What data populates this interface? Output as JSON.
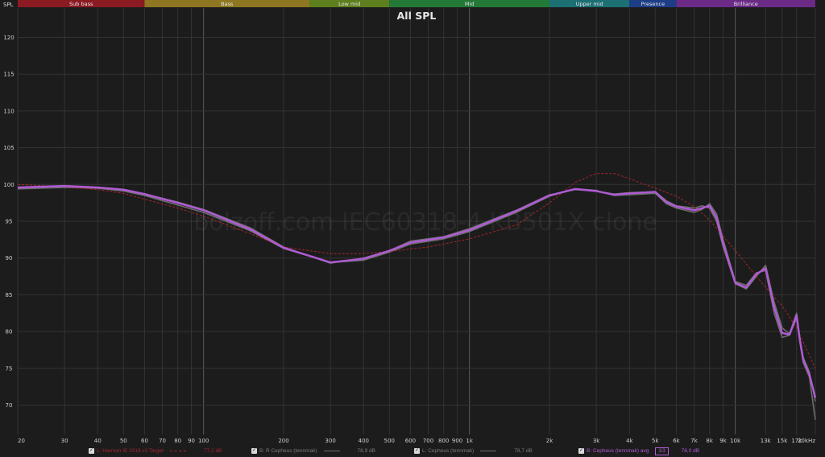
{
  "bands": [
    {
      "label": "Sub bass",
      "color": "#8b1a22"
    },
    {
      "label": "Bass",
      "color": "#8e7720"
    },
    {
      "label": "Low mid",
      "color": "#5d7f1e"
    },
    {
      "label": "Mid",
      "color": "#237a36"
    },
    {
      "label": "Upper mid",
      "color": "#1c6f73"
    },
    {
      "label": "Presence",
      "color": "#1e3d87"
    },
    {
      "label": "Brilliance",
      "color": "#6a2a86"
    }
  ],
  "watermark": "bolzoff.com IEC60318-4 KB501X clone",
  "legend": [
    {
      "name": "L: Harman IE 2019 v2 Target",
      "value": "77,2 dB",
      "color": "#a1262c",
      "dash": true
    },
    {
      "name": "B: R Cepheus (tennmak)",
      "value": "78,9 dB",
      "color": "#777777",
      "dash": false
    },
    {
      "name": "L: Cepheus (tennmak)",
      "value": "78,7 dB",
      "color": "#777777",
      "dash": false
    },
    {
      "name": "B: Cepheus (tennmak) avg",
      "value": "78,0 dB",
      "color": "#b15ad6",
      "dash": false,
      "badge": "1/3"
    }
  ],
  "chart_data": {
    "type": "line",
    "title": "All SPL",
    "ylabel": "SPL",
    "xlabel": "",
    "xscale": "log",
    "xlim": [
      20,
      20000
    ],
    "ylim": [
      66,
      124
    ],
    "grid": true,
    "yticks": [
      70,
      75,
      80,
      85,
      90,
      95,
      100,
      105,
      110,
      115,
      120
    ],
    "xticks": [
      {
        "v": 20,
        "label": "20"
      },
      {
        "v": 30,
        "label": "30"
      },
      {
        "v": 40,
        "label": "40"
      },
      {
        "v": 50,
        "label": "50"
      },
      {
        "v": 60,
        "label": "60"
      },
      {
        "v": 70,
        "label": "70"
      },
      {
        "v": 80,
        "label": "80"
      },
      {
        "v": 90,
        "label": "90"
      },
      {
        "v": 100,
        "label": "100"
      },
      {
        "v": 200,
        "label": "200"
      },
      {
        "v": 300,
        "label": "300"
      },
      {
        "v": 400,
        "label": "400"
      },
      {
        "v": 500,
        "label": "500"
      },
      {
        "v": 600,
        "label": "600"
      },
      {
        "v": 700,
        "label": "700"
      },
      {
        "v": 800,
        "label": "800"
      },
      {
        "v": 900,
        "label": "900"
      },
      {
        "v": 1000,
        "label": "1k"
      },
      {
        "v": 2000,
        "label": "2k"
      },
      {
        "v": 3000,
        "label": "3k"
      },
      {
        "v": 4000,
        "label": "4k"
      },
      {
        "v": 5000,
        "label": "5k"
      },
      {
        "v": 6000,
        "label": "6k"
      },
      {
        "v": 7000,
        "label": "7k"
      },
      {
        "v": 8000,
        "label": "8k"
      },
      {
        "v": 9000,
        "label": "9k"
      },
      {
        "v": 10000,
        "label": "10k"
      },
      {
        "v": 13000,
        "label": "13k"
      },
      {
        "v": 15000,
        "label": "15k"
      },
      {
        "v": 17000,
        "label": "17k"
      },
      {
        "v": 20000,
        "label": "20kHz"
      }
    ],
    "band_edges": [
      20,
      60,
      250,
      500,
      2000,
      4000,
      6000,
      20000
    ],
    "series": [
      {
        "name": "L: Harman IE 2019 v2 Target",
        "color": "#a1262c",
        "style": "dashed",
        "x": [
          20,
          30,
          40,
          50,
          60,
          80,
          100,
          150,
          200,
          300,
          400,
          500,
          700,
          1000,
          1500,
          2000,
          2500,
          3000,
          3500,
          4000,
          5000,
          6000,
          7000,
          8000,
          10000,
          13000,
          15000,
          17000,
          20000
        ],
        "y": [
          100,
          99.7,
          99.3,
          98.8,
          98,
          96.8,
          95.7,
          93.3,
          91.5,
          90.6,
          90.6,
          90.9,
          91.5,
          92.6,
          94.5,
          97.5,
          100.3,
          101.5,
          101.5,
          100.8,
          99.5,
          98.4,
          97,
          95.2,
          91,
          86,
          83.5,
          80.5,
          75
        ]
      },
      {
        "name": "B: R Cepheus (tennmak)",
        "color": "#6e6e6e",
        "style": "solid",
        "x": [
          20,
          30,
          40,
          50,
          60,
          80,
          100,
          150,
          200,
          300,
          400,
          500,
          600,
          800,
          1000,
          1500,
          2000,
          2500,
          3000,
          3500,
          4000,
          5000,
          5500,
          6000,
          7000,
          7500,
          8000,
          8500,
          9000,
          10000,
          11000,
          12000,
          13000,
          14000,
          15000,
          16000,
          17000,
          17500,
          18000,
          19000,
          20000
        ],
        "y": [
          99.6,
          99.8,
          99.5,
          99.3,
          98.7,
          97.6,
          96.6,
          94.1,
          91.5,
          89.3,
          90,
          91,
          92.3,
          92.9,
          94,
          96.5,
          98.6,
          99.3,
          99.1,
          98.7,
          98.9,
          99,
          97.8,
          97.1,
          96.8,
          97.1,
          96.8,
          95,
          91.5,
          86.5,
          85.8,
          87.5,
          89,
          84,
          80.5,
          79.7,
          82.5,
          79,
          76.5,
          74.5,
          70.5
        ]
      },
      {
        "name": "L: Cepheus (tennmak)",
        "color": "#6e6e6e",
        "style": "solid",
        "x": [
          20,
          30,
          40,
          50,
          60,
          80,
          100,
          150,
          200,
          300,
          400,
          500,
          600,
          800,
          1000,
          1500,
          2000,
          2500,
          3000,
          3500,
          4000,
          5000,
          5500,
          6000,
          7000,
          7500,
          8000,
          8500,
          9000,
          10000,
          11000,
          12000,
          13000,
          14000,
          15000,
          16000,
          17000,
          17500,
          18000,
          19000,
          20000
        ],
        "y": [
          99.4,
          99.6,
          99.5,
          99.1,
          98.5,
          97.2,
          96.2,
          93.7,
          91.3,
          89.4,
          89.7,
          90.8,
          91.9,
          92.6,
          93.6,
          96.2,
          98.4,
          99.4,
          99.2,
          98.5,
          98.6,
          98.8,
          97.4,
          96.8,
          96.2,
          96.6,
          97.4,
          96,
          92.5,
          86.8,
          86.3,
          88,
          88.3,
          82.5,
          79.2,
          79.5,
          81.8,
          78.5,
          75.8,
          73.8,
          68
        ]
      },
      {
        "name": "B: Cepheus (tennmak) avg",
        "color": "#b15ad6",
        "style": "solid",
        "x": [
          20,
          30,
          40,
          50,
          60,
          80,
          100,
          150,
          200,
          300,
          400,
          500,
          600,
          800,
          1000,
          1500,
          2000,
          2500,
          3000,
          3500,
          4000,
          5000,
          5500,
          6000,
          7000,
          7500,
          8000,
          8500,
          9000,
          10000,
          11000,
          12000,
          13000,
          14000,
          15000,
          16000,
          17000,
          17500,
          18000,
          19000,
          20000
        ],
        "y": [
          99.6,
          99.8,
          99.6,
          99.3,
          98.7,
          97.5,
          96.5,
          93.9,
          91.4,
          89.4,
          89.9,
          91,
          92.1,
          92.8,
          93.8,
          96.4,
          98.5,
          99.4,
          99.1,
          98.6,
          98.8,
          99,
          97.6,
          97,
          96.5,
          96.8,
          97.1,
          95.5,
          92,
          86.6,
          86,
          87.8,
          88.6,
          83.3,
          79.8,
          79.6,
          82.2,
          78.8,
          76.2,
          74.2,
          71
        ]
      }
    ]
  }
}
